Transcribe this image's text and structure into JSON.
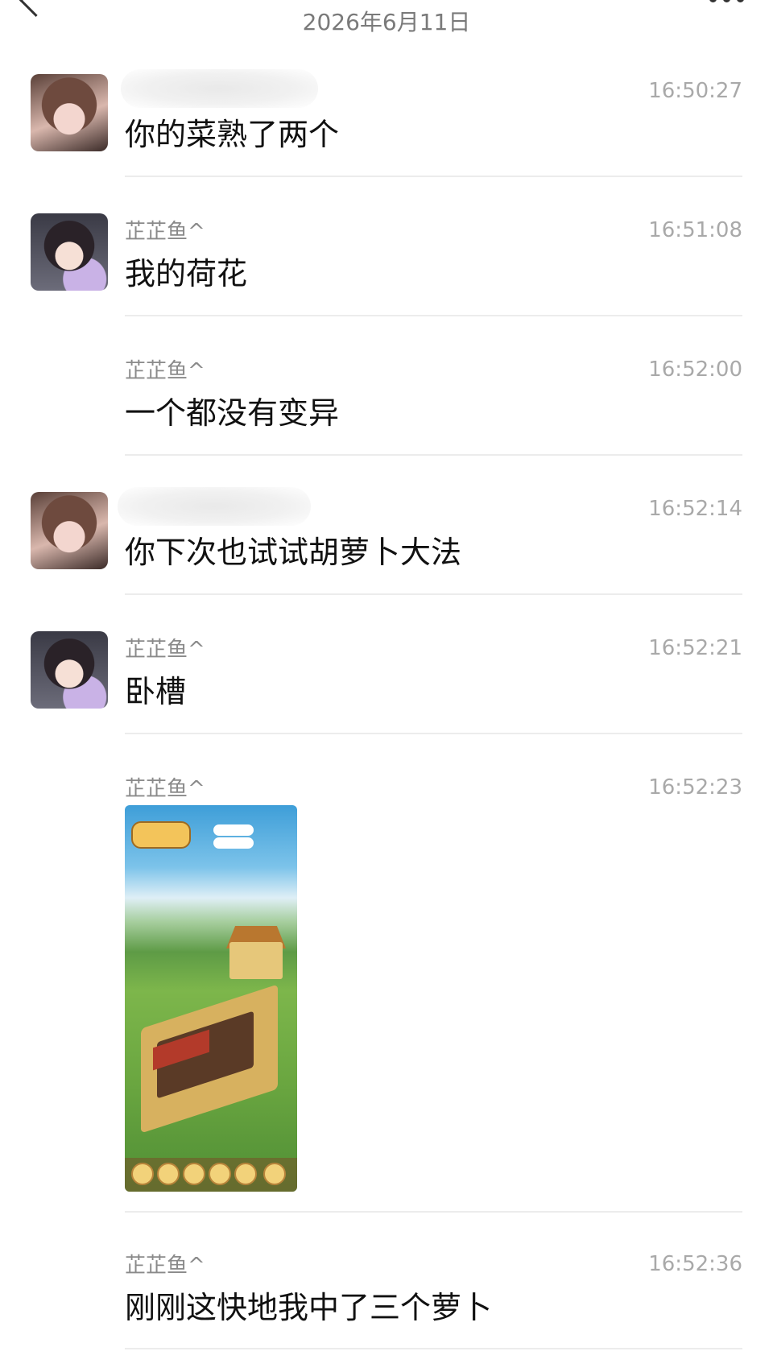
{
  "header": {
    "date": "2026年6月11日"
  },
  "messages": [
    {
      "sender": "",
      "sender_blurred": true,
      "time": "16:50:27",
      "text": "你的菜熟了两个",
      "avatar": "avatar-a"
    },
    {
      "sender": "芷芷鱼^",
      "time": "16:51:08",
      "text": "我的荷花",
      "avatar": "avatar-b"
    },
    {
      "sender": "芷芷鱼^",
      "time": "16:52:00",
      "text": "一个都没有变异",
      "avatar": ""
    },
    {
      "sender": "",
      "sender_blurred": true,
      "time": "16:52:14",
      "text": "你下次也试试胡萝卜大法",
      "avatar": "avatar-a"
    },
    {
      "sender": "芷芷鱼^",
      "time": "16:52:21",
      "text": "卧槽",
      "avatar": "avatar-b"
    },
    {
      "sender": "芷芷鱼^",
      "time": "16:52:23",
      "text": "",
      "image": "farm-game-screenshot",
      "avatar": ""
    },
    {
      "sender": "芷芷鱼^",
      "time": "16:52:36",
      "text": "刚刚这快地我中了三个萝卜",
      "avatar": ""
    }
  ]
}
